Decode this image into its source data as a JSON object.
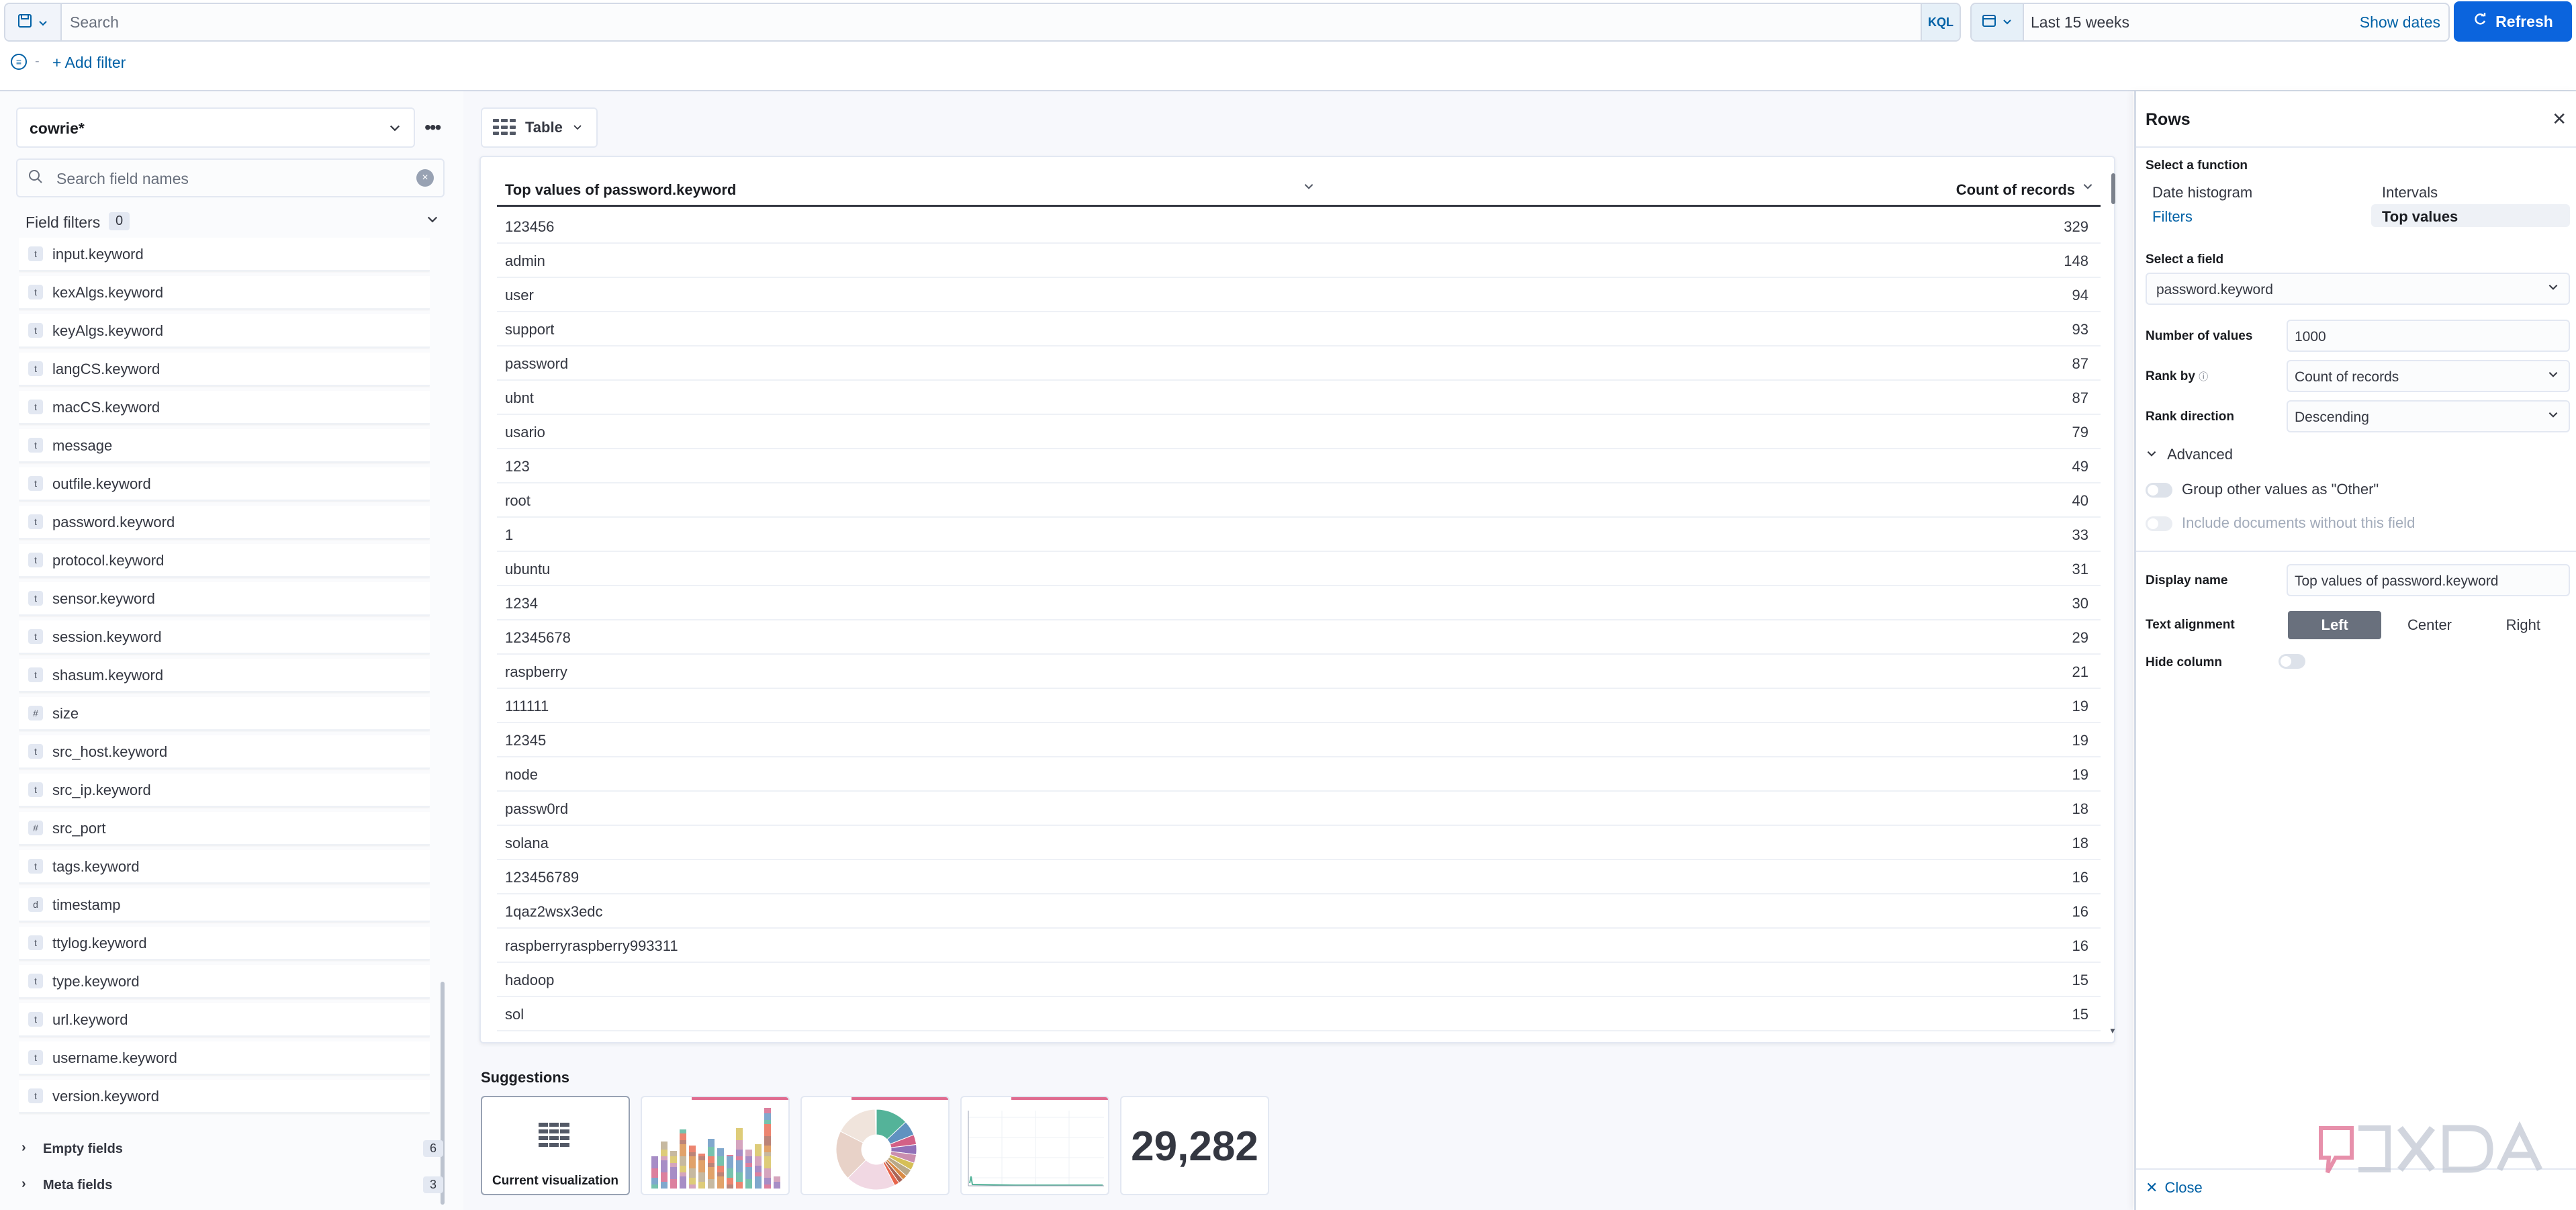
{
  "query_bar": {
    "search_placeholder": "Search",
    "language": "KQL",
    "time_range": "Last 15 weeks",
    "show_dates_label": "Show dates",
    "refresh_label": "Refresh",
    "add_filter_label": "+ Add filter"
  },
  "left_panel": {
    "data_view": "cowrie*",
    "field_search_placeholder": "Search field names",
    "field_filters_label": "Field filters",
    "field_filters_count": "0",
    "fields": [
      {
        "type": "t",
        "name": "input.keyword"
      },
      {
        "type": "t",
        "name": "kexAlgs.keyword"
      },
      {
        "type": "t",
        "name": "keyAlgs.keyword"
      },
      {
        "type": "t",
        "name": "langCS.keyword"
      },
      {
        "type": "t",
        "name": "macCS.keyword"
      },
      {
        "type": "t",
        "name": "message"
      },
      {
        "type": "t",
        "name": "outfile.keyword"
      },
      {
        "type": "t",
        "name": "password.keyword"
      },
      {
        "type": "t",
        "name": "protocol.keyword"
      },
      {
        "type": "t",
        "name": "sensor.keyword"
      },
      {
        "type": "t",
        "name": "session.keyword"
      },
      {
        "type": "t",
        "name": "shasum.keyword"
      },
      {
        "type": "#",
        "name": "size"
      },
      {
        "type": "t",
        "name": "src_host.keyword"
      },
      {
        "type": "t",
        "name": "src_ip.keyword"
      },
      {
        "type": "#",
        "name": "src_port"
      },
      {
        "type": "t",
        "name": "tags.keyword"
      },
      {
        "type": "d",
        "name": "timestamp"
      },
      {
        "type": "t",
        "name": "ttylog.keyword"
      },
      {
        "type": "t",
        "name": "type.keyword"
      },
      {
        "type": "t",
        "name": "url.keyword"
      },
      {
        "type": "t",
        "name": "username.keyword"
      },
      {
        "type": "t",
        "name": "version.keyword"
      }
    ],
    "empty_fields_label": "Empty fields",
    "empty_fields_count": "6",
    "meta_fields_label": "Meta fields",
    "meta_fields_count": "3"
  },
  "workspace": {
    "viz_type_label": "Table",
    "table": {
      "col1_header": "Top values of password.keyword",
      "col2_header": "Count of records",
      "rows": [
        {
          "value": "123456",
          "count": "329"
        },
        {
          "value": "admin",
          "count": "148"
        },
        {
          "value": "user",
          "count": "94"
        },
        {
          "value": "support",
          "count": "93"
        },
        {
          "value": "password",
          "count": "87"
        },
        {
          "value": "ubnt",
          "count": "87"
        },
        {
          "value": "usario",
          "count": "79"
        },
        {
          "value": "123",
          "count": "49"
        },
        {
          "value": "root",
          "count": "40"
        },
        {
          "value": "1",
          "count": "33"
        },
        {
          "value": "ubuntu",
          "count": "31"
        },
        {
          "value": "1234",
          "count": "30"
        },
        {
          "value": "12345678",
          "count": "29"
        },
        {
          "value": "raspberry",
          "count": "21"
        },
        {
          "value": "111111",
          "count": "19"
        },
        {
          "value": "12345",
          "count": "19"
        },
        {
          "value": "node",
          "count": "19"
        },
        {
          "value": "passw0rd",
          "count": "18"
        },
        {
          "value": "solana",
          "count": "18"
        },
        {
          "value": "123456789",
          "count": "16"
        },
        {
          "value": "1qaz2wsx3edc",
          "count": "16"
        },
        {
          "value": "raspberryraspberry993311",
          "count": "16"
        },
        {
          "value": "hadoop",
          "count": "15"
        },
        {
          "value": "sol",
          "count": "15"
        }
      ]
    },
    "suggestions_title": "Suggestions",
    "current_visualization_label": "Current visualization",
    "metric_suggestion_value": "29,282"
  },
  "right_panel": {
    "title": "Rows",
    "select_function_label": "Select a function",
    "functions": {
      "date_histogram": "Date histogram",
      "intervals": "Intervals",
      "filters": "Filters",
      "top_values": "Top values"
    },
    "select_field_label": "Select a field",
    "field_value": "password.keyword",
    "number_of_values_label": "Number of values",
    "number_of_values": "1000",
    "rank_by_label": "Rank by",
    "rank_by_value": "Count of records",
    "rank_direction_label": "Rank direction",
    "rank_direction_value": "Descending",
    "advanced_label": "Advanced",
    "group_other_label": "Group other values as \"Other\"",
    "include_docs_label": "Include documents without this field",
    "display_name_label": "Display name",
    "display_name_value": "Top values of password.keyword",
    "text_alignment_label": "Text alignment",
    "align_left": "Left",
    "align_center": "Center",
    "align_right": "Right",
    "hide_column_label": "Hide column",
    "close_label": "Close"
  },
  "colors": {
    "primary": "#0b64dd",
    "link": "#0061a6",
    "suggestion_accent": "#e06b8f"
  }
}
